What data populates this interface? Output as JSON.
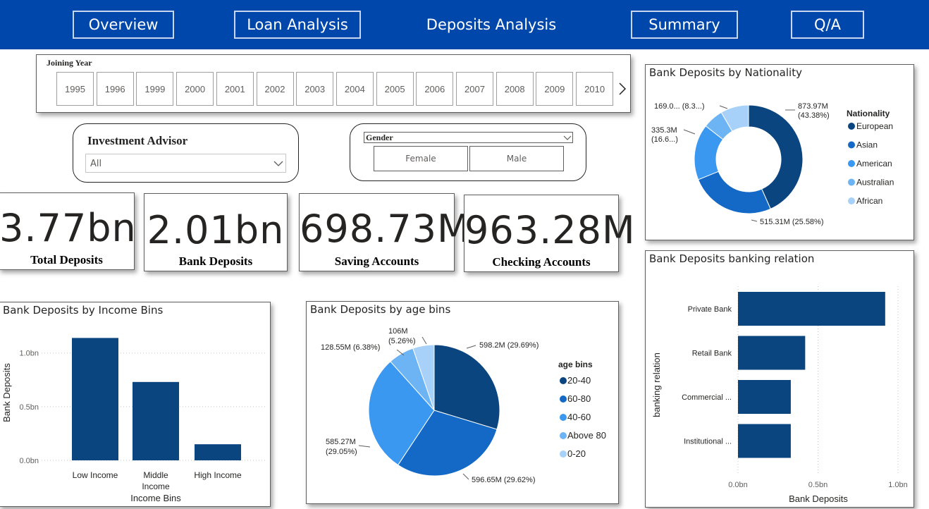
{
  "nav": {
    "tabs": [
      {
        "label": "Overview"
      },
      {
        "label": "Loan Analysis"
      },
      {
        "label": "Deposits Analysis"
      },
      {
        "label": "Summary"
      },
      {
        "label": "Q/A"
      }
    ]
  },
  "joining_year": {
    "title": "Joining Year",
    "years": [
      "1995",
      "1996",
      "1999",
      "2000",
      "2001",
      "2002",
      "2003",
      "2004",
      "2005",
      "2006",
      "2007",
      "2008",
      "2009",
      "2010"
    ],
    "next_icon": "chevron-right-icon"
  },
  "advisor": {
    "title": "Investment Advisor",
    "value": "All",
    "icon": "chevron-down-icon"
  },
  "gender": {
    "title": "Gender",
    "options": [
      "Female",
      "Male"
    ],
    "icon": "chevron-down-icon"
  },
  "kpis": [
    {
      "value": "3.77bn",
      "label": "Total Deposits"
    },
    {
      "value": "2.01bn",
      "label": "Bank Deposits"
    },
    {
      "value": "698.73M",
      "label": "Saving Accounts"
    },
    {
      "value": "963.28M",
      "label": "Checking Accounts"
    }
  ],
  "colors": {
    "nav_bg": "#0047ab",
    "bar": "#0b4580",
    "c1": "#0b4580",
    "c2": "#1469c7",
    "c3": "#3b98f0",
    "c4": "#6db4f5",
    "c5": "#a8d1fa"
  },
  "chart_data": [
    {
      "id": "nationality",
      "type": "pie",
      "title": "Bank Deposits by Nationality",
      "donut": true,
      "legend_title": "Nationality",
      "legend_position": "right",
      "slices": [
        {
          "label": "European",
          "value": 873.97,
          "data_label": "873.97M (43.38%)"
        },
        {
          "label": "Asian",
          "value": 515.31,
          "data_label": "515.31M (25.58%)"
        },
        {
          "label": "American",
          "value": 335.3,
          "data_label": "335.3M (16.6...)"
        },
        {
          "label": "Australian",
          "value": 122.8,
          "data_label": ""
        },
        {
          "label": "African",
          "value": 169.0,
          "data_label": "169.0... (8.3...)"
        }
      ]
    },
    {
      "id": "banking_relation",
      "type": "bar",
      "orientation": "horizontal",
      "title": "Bank Deposits banking relation",
      "xlabel": "Bank Deposits",
      "ylabel": "banking relation",
      "categories": [
        "Private Bank",
        "Retail Bank",
        "Commercial ...",
        "Institutional ..."
      ],
      "values": [
        0.92,
        0.42,
        0.33,
        0.33
      ],
      "xlim": [
        0,
        1.0
      ],
      "ticks": [
        {
          "value": 0,
          "label": "0.0bn"
        },
        {
          "value": 0.5,
          "label": "0.5bn"
        },
        {
          "value": 1.0,
          "label": "1.0bn"
        }
      ],
      "grid": true
    },
    {
      "id": "income_bins",
      "type": "bar",
      "title": "Bank Deposits by Income Bins",
      "xlabel": "Income Bins",
      "ylabel": "Bank Deposits",
      "categories": [
        "Low Income",
        "Middle Income",
        "High Income"
      ],
      "values": [
        1.14,
        0.73,
        0.15
      ],
      "ylim": [
        0,
        1.3
      ],
      "ticks": [
        {
          "value": 0,
          "label": "0.0bn"
        },
        {
          "value": 0.5,
          "label": "0.5bn"
        },
        {
          "value": 1.0,
          "label": "1.0bn"
        }
      ],
      "grid": true
    },
    {
      "id": "age_bins",
      "type": "pie",
      "title": "Bank Deposits by age bins",
      "legend_title": "age bins",
      "legend_position": "right",
      "slices": [
        {
          "label": "20-40",
          "value": 598.2,
          "data_label": "598.2M (29.69%)"
        },
        {
          "label": "60-80",
          "value": 596.65,
          "data_label": "596.65M (29.62%)"
        },
        {
          "label": "40-60",
          "value": 585.27,
          "data_label": "585.27M (29.05%)"
        },
        {
          "label": "Above 80",
          "value": 128.55,
          "data_label": "128.55M (6.38%)"
        },
        {
          "label": "0-20",
          "value": 106,
          "data_label": "106M (5.26%)"
        }
      ]
    }
  ]
}
